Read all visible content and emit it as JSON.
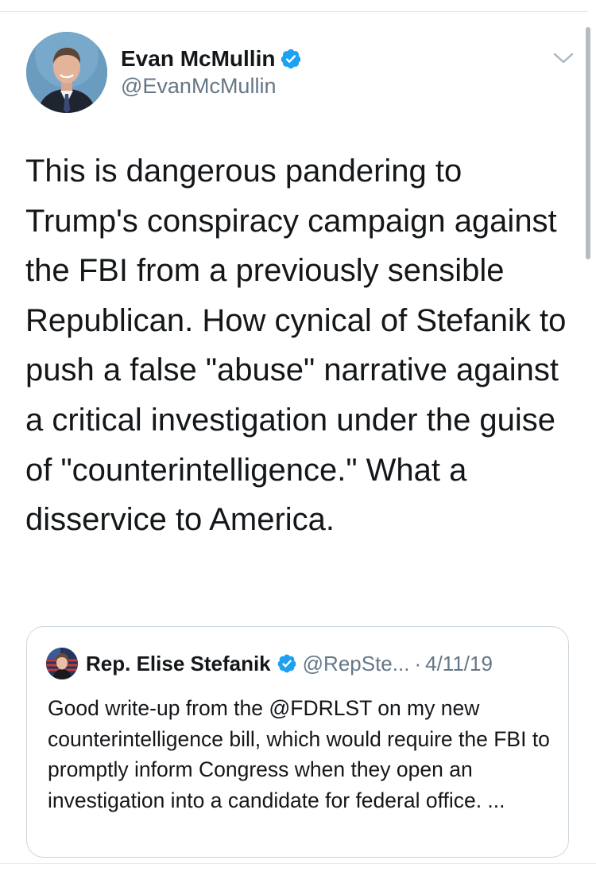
{
  "author": {
    "name": "Evan McMullin",
    "handle": "@EvanMcMullin",
    "avatar_icon": "profile-photo",
    "verified_icon": "verified-badge-icon"
  },
  "menu_icon": "chevron-down-icon",
  "tweet": {
    "text": "This is dangerous pandering to Trump's conspiracy campaign against the FBI from a previously sensible Republican. How cynical of Stefanik to push a false \"abuse\" narrative against a critical investigation under the guise of \"counterintelligence.\" What a disservice to America."
  },
  "quoted_tweet": {
    "name": "Rep. Elise Stefanik",
    "handle": "@RepSte...",
    "separator": "·",
    "date": "4/11/19",
    "text": "Good write-up from the @FDRLST on my new counterintelligence bill, which would require the FBI to promptly inform Congress when they open an investigation into a candidate for federal office. ..."
  },
  "colors": {
    "text": "#14171a",
    "secondary": "#657786",
    "verified": "#1da1f2",
    "border": "#ccd6dd"
  }
}
